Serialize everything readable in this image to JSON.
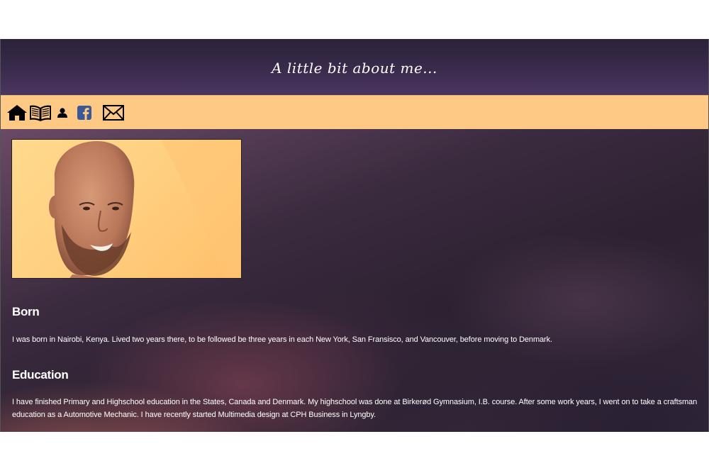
{
  "header": {
    "title": "A little bit about me...",
    "background_color": "#3a2b4d"
  },
  "navbar": {
    "background_color": "#fdc984",
    "icons": [
      "home-icon",
      "book-icon",
      "person-icon",
      "facebook-icon",
      "mail-icon"
    ]
  },
  "profile": {
    "photo_icon": "profile-photo"
  },
  "sections": {
    "born": {
      "heading": "Born",
      "text": "I was born in Nairobi, Kenya. Lived two years there, to be followed be three years in each New York, San Fransisco, and Vancouver, before moving to Denmark."
    },
    "education": {
      "heading": "Education",
      "text": "I have finished Primary and Highschool education in the States, Canada and Denmark. My highschool was done at Birkerød Gymnasium, I.B. course. After some work years, I went on to take a craftsman education as a Automotive Mechanic. I have recently started Multimedia design at CPH Business in Lyngby."
    }
  }
}
